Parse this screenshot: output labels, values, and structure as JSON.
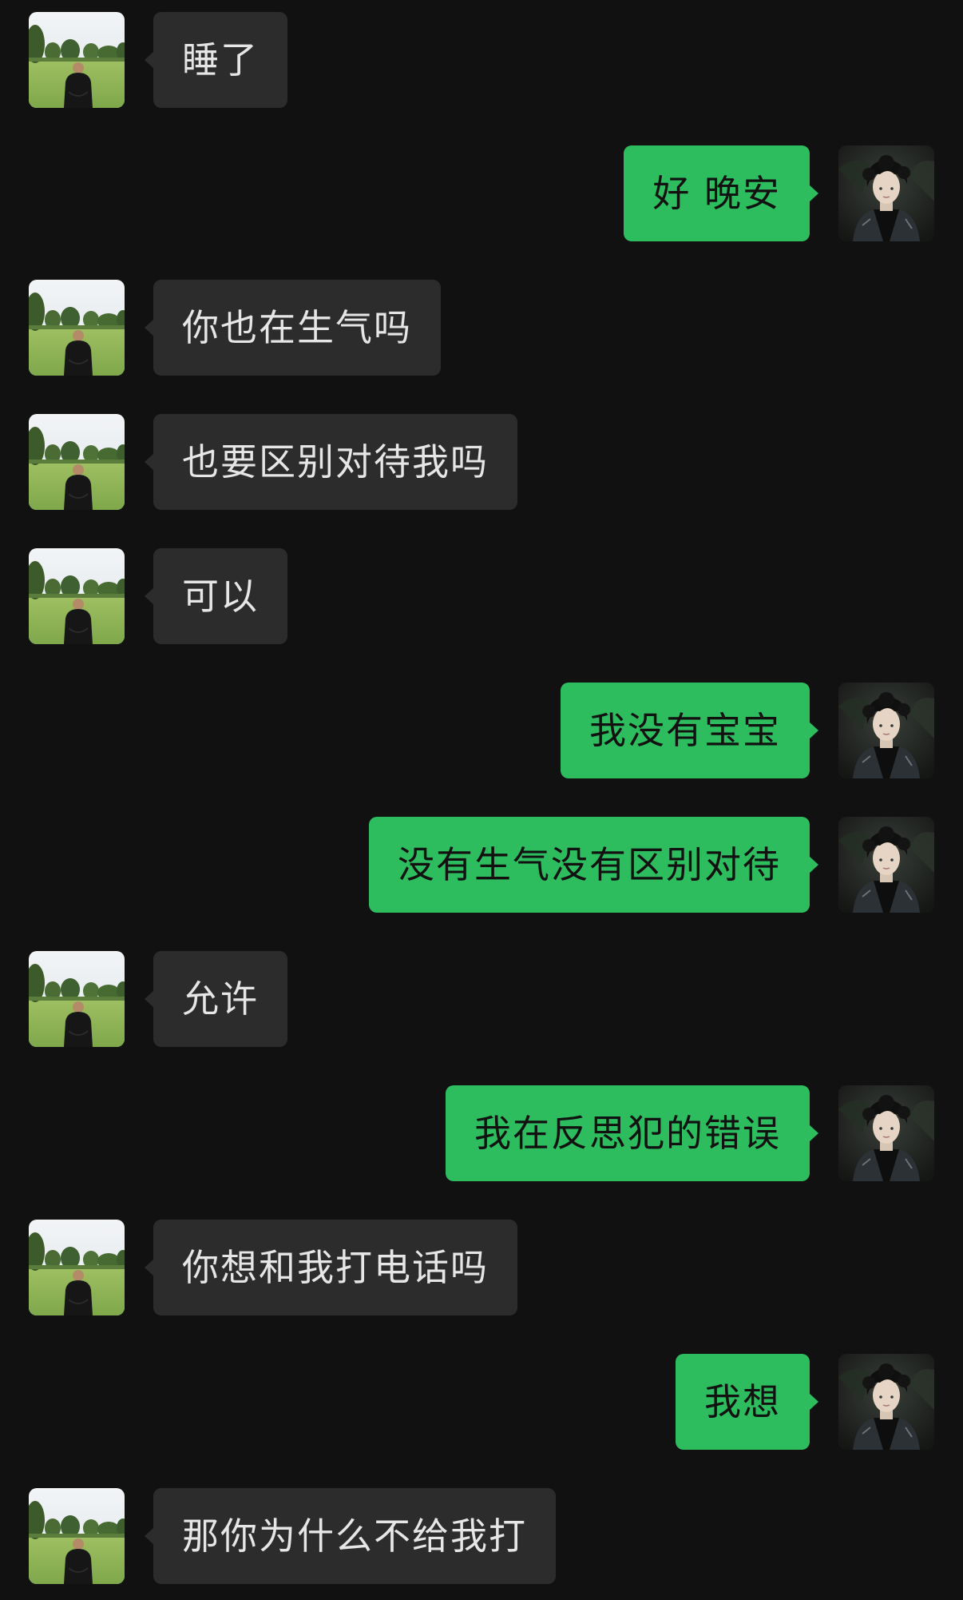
{
  "messages": [
    {
      "side": "in",
      "text": "睡了"
    },
    {
      "side": "out",
      "text": "好 晚安"
    },
    {
      "side": "in",
      "text": "你也在生气吗"
    },
    {
      "side": "in",
      "text": "也要区别对待我吗"
    },
    {
      "side": "in",
      "text": "可以"
    },
    {
      "side": "out",
      "text": "我没有宝宝"
    },
    {
      "side": "out",
      "text": "没有生气没有区别对待"
    },
    {
      "side": "in",
      "text": "允许"
    },
    {
      "side": "out",
      "text": "我在反思犯的错误"
    },
    {
      "side": "in",
      "text": "你想和我打电话吗"
    },
    {
      "side": "out",
      "text": "我想"
    },
    {
      "side": "in",
      "text": "那你为什么不给我打"
    }
  ],
  "avatars": {
    "contact": "grass-field-person-avatar",
    "self": "dark-portrait-avatar"
  },
  "colors": {
    "background": "#111111",
    "incoming_bubble": "#2c2c2c",
    "outgoing_bubble": "#2dbd5f"
  }
}
